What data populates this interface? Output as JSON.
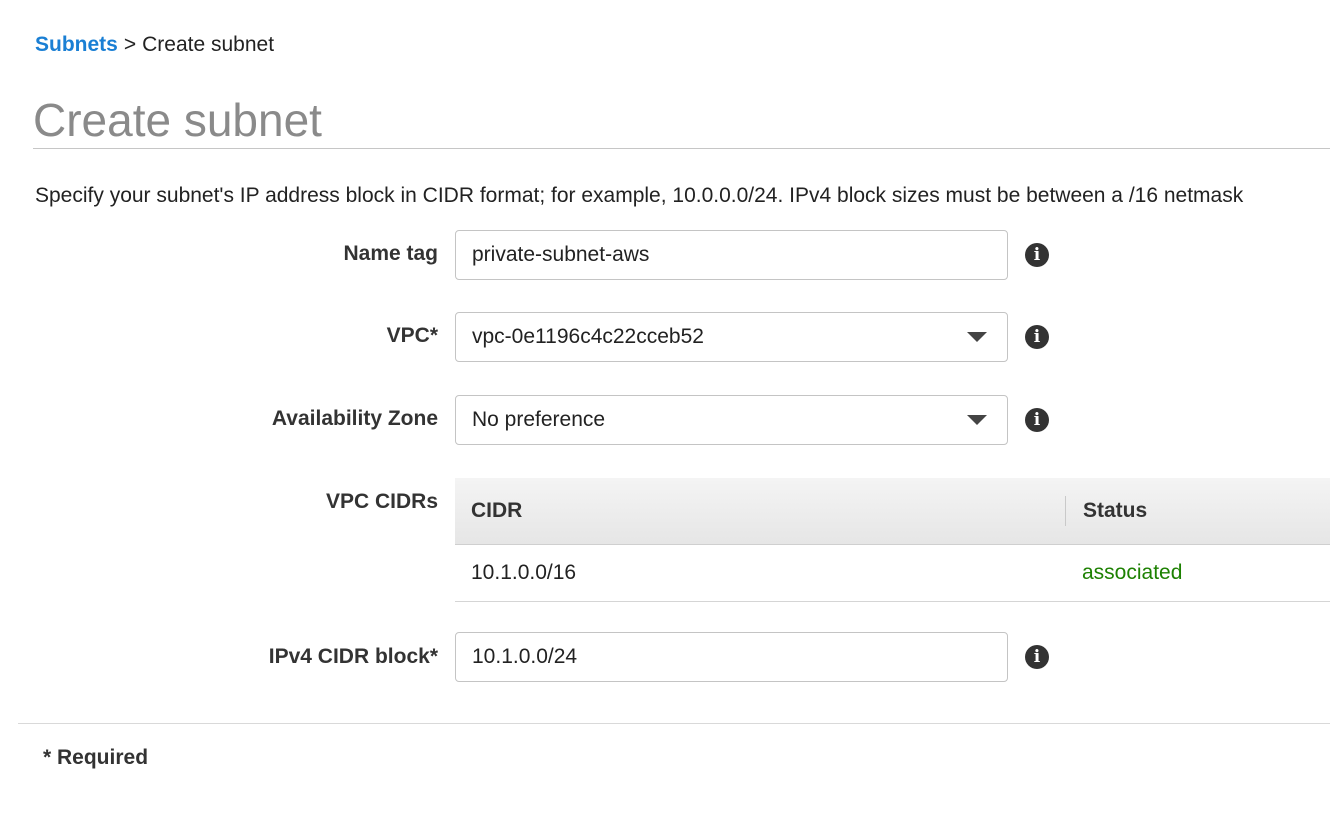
{
  "breadcrumb": {
    "parent_label": "Subnets",
    "separator": ">",
    "current_label": "Create subnet"
  },
  "page": {
    "title": "Create subnet",
    "description": "Specify your subnet's IP address block in CIDR format; for example, 10.0.0.0/24. IPv4 block sizes must be between a /16 netmask"
  },
  "form": {
    "name_tag": {
      "label": "Name tag",
      "value": "private-subnet-aws",
      "info_icon": "info-icon"
    },
    "vpc": {
      "label": "VPC*",
      "value": "vpc-0e1196c4c22cceb52",
      "info_icon": "info-icon"
    },
    "availability_zone": {
      "label": "Availability Zone",
      "value": "No preference",
      "info_icon": "info-icon"
    },
    "vpc_cidrs": {
      "label": "VPC CIDRs",
      "columns": [
        "CIDR",
        "Status"
      ],
      "rows": [
        {
          "cidr": "10.1.0.0/16",
          "status": "associated"
        }
      ]
    },
    "ipv4_cidr_block": {
      "label": "IPv4 CIDR block*",
      "value": "10.1.0.0/24",
      "info_icon": "info-icon"
    }
  },
  "footer": {
    "required_note": "* Required"
  },
  "colors": {
    "link": "#1a7fd4",
    "status_associated": "#1d8102",
    "title": "#8a8a8a"
  }
}
